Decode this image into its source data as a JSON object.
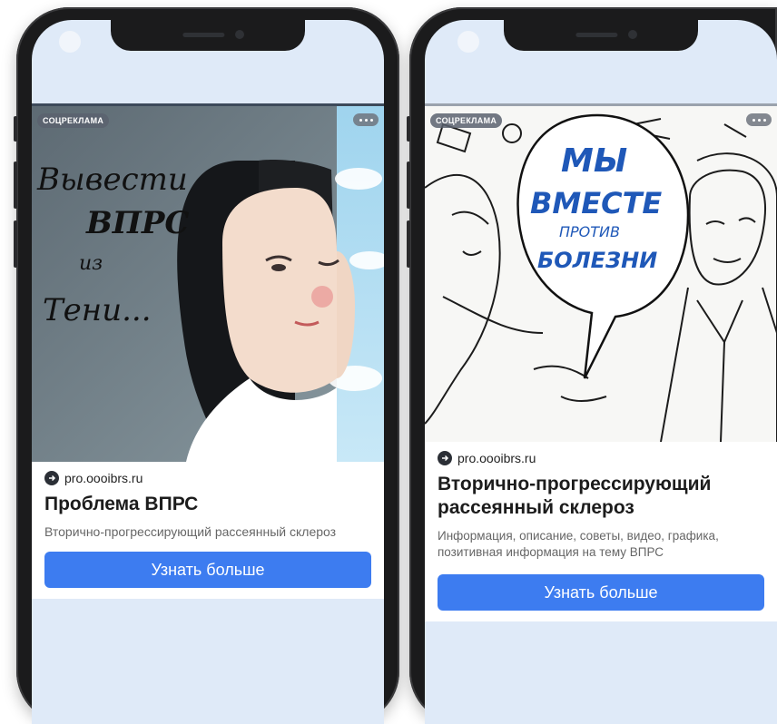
{
  "ads": [
    {
      "badge": "СОЦРЕКЛАМА",
      "image_text": {
        "line1": "Вывести",
        "line2": "ВПРС",
        "line3": "из",
        "line4": "Тени..."
      },
      "domain": "pro.oooibrs.ru",
      "headline": "Проблема ВПРС",
      "description": "Вторично-прогрессирующий рассеянный склероз",
      "cta": "Узнать больше"
    },
    {
      "badge": "СОЦРЕКЛАМА",
      "image_text": {
        "line1": "МЫ",
        "line2": "ВМЕСТЕ",
        "line3": "ПРОТИВ",
        "line4": "БОЛЕЗНИ"
      },
      "domain": "pro.oooibrs.ru",
      "headline": "Вторично-прогрессирующий рассеянный склероз",
      "description": "Информация, описание, советы, видео, графика, позитивная информация на тему ВПРС",
      "cta": "Узнать больше"
    }
  ],
  "colors": {
    "cta": "#3d7cf0",
    "screen_bg": "#dfeaf8",
    "phone": "#1b1b1c"
  }
}
